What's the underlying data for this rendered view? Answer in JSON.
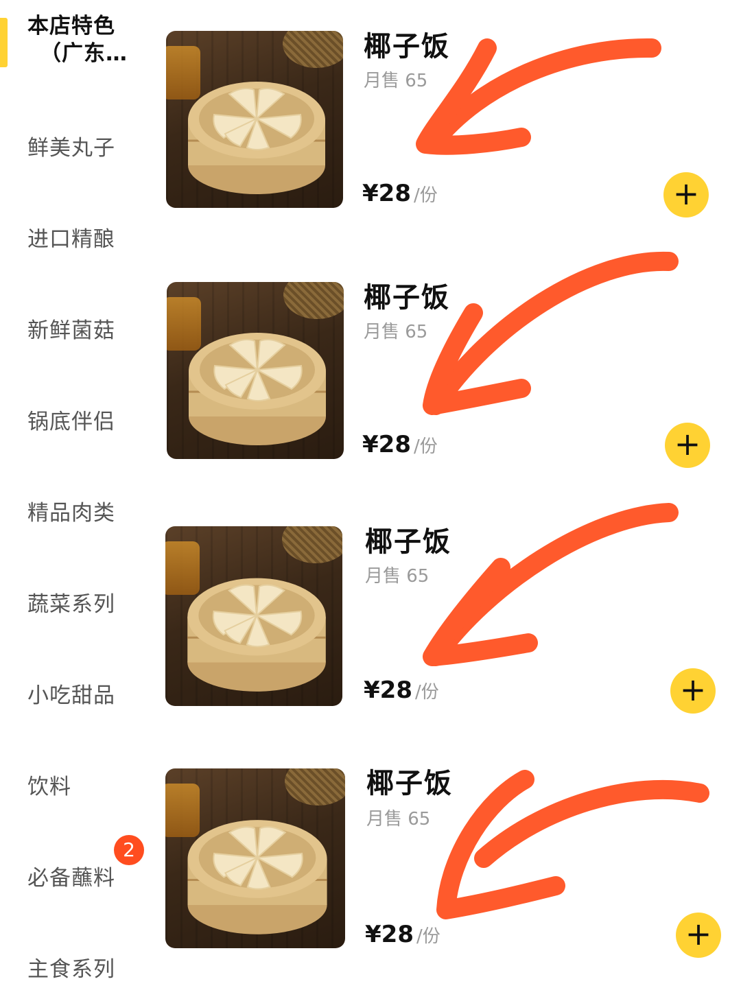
{
  "sidebar": {
    "active_indicator_color": "#FFD233",
    "categories": [
      {
        "label_line1": "本店特色",
        "label_line2": "（广东…",
        "active": true
      },
      {
        "label": "鲜美丸子"
      },
      {
        "label": "进口精酿"
      },
      {
        "label": "新鲜菌菇"
      },
      {
        "label": "锅底伴侣"
      },
      {
        "label": "精品肉类"
      },
      {
        "label": "蔬菜系列"
      },
      {
        "label": "小吃甜品"
      },
      {
        "label": "饮料"
      },
      {
        "label": "必备蘸料",
        "badge": "2"
      },
      {
        "label": "主食系列"
      }
    ]
  },
  "products": [
    {
      "name": "椰子饭",
      "sales": "月售 65",
      "currency": "¥",
      "price": "28",
      "unit": "/份",
      "add_icon": "plus-icon"
    },
    {
      "name": "椰子饭",
      "sales": "月售 65",
      "currency": "¥",
      "price": "28",
      "unit": "/份",
      "add_icon": "plus-icon"
    },
    {
      "name": "椰子饭",
      "sales": "月售 65",
      "currency": "¥",
      "price": "28",
      "unit": "/份",
      "add_icon": "plus-icon"
    },
    {
      "name": "椰子饭",
      "sales": "月售 65",
      "currency": "¥",
      "price": "28",
      "unit": "/份",
      "add_icon": "plus-icon"
    }
  ],
  "colors": {
    "accent_yellow": "#FFD233",
    "badge_red": "#FF4D1F",
    "annotation_arrow": "#FF5A2C"
  }
}
